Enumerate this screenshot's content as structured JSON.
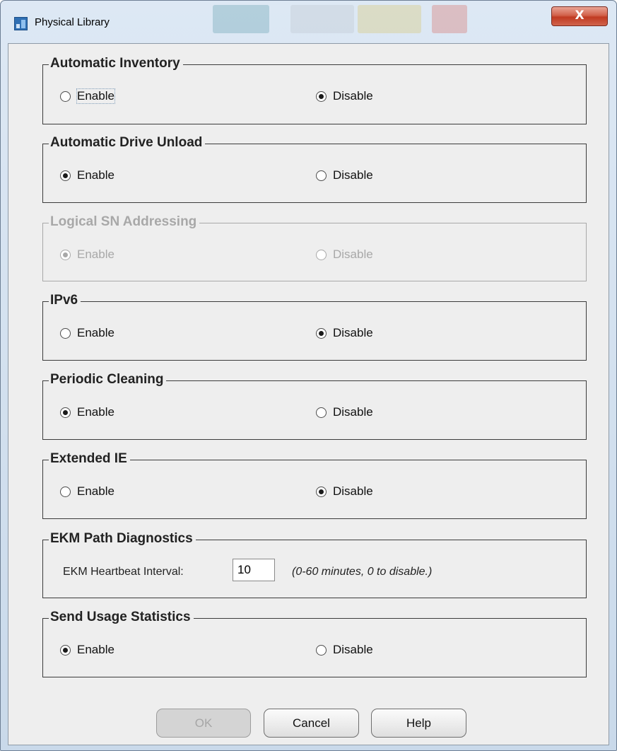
{
  "window": {
    "title": "Physical Library",
    "close_label": "X"
  },
  "groups": {
    "automatic_inventory": {
      "legend": "Automatic Inventory",
      "enable": "Enable",
      "disable": "Disable",
      "selected": "Disable"
    },
    "automatic_drive_unload": {
      "legend": "Automatic Drive Unload",
      "enable": "Enable",
      "disable": "Disable",
      "selected": "Enable"
    },
    "logical_sn_addressing": {
      "legend": "Logical SN Addressing",
      "enable": "Enable",
      "disable": "Disable",
      "selected": "Enable",
      "disabled": true
    },
    "ipv6": {
      "legend": "IPv6",
      "enable": "Enable",
      "disable": "Disable",
      "selected": "Disable"
    },
    "periodic_cleaning": {
      "legend": "Periodic Cleaning",
      "enable": "Enable",
      "disable": "Disable",
      "selected": "Enable"
    },
    "extended_ie": {
      "legend": "Extended IE",
      "enable": "Enable",
      "disable": "Disable",
      "selected": "Disable"
    },
    "ekm_path_diagnostics": {
      "legend": "EKM Path Diagnostics",
      "label": "EKM Heartbeat Interval:",
      "value": "10",
      "hint": "(0-60 minutes, 0 to disable.)"
    },
    "send_usage_statistics": {
      "legend": "Send Usage Statistics",
      "enable": "Enable",
      "disable": "Disable",
      "selected": "Enable"
    }
  },
  "buttons": {
    "ok": "OK",
    "cancel": "Cancel",
    "help": "Help",
    "ok_disabled": true
  },
  "colors": {
    "close_red": "#c03b22",
    "disabled_text": "#a8a8a8",
    "window_frame": "#c9d9ea"
  }
}
